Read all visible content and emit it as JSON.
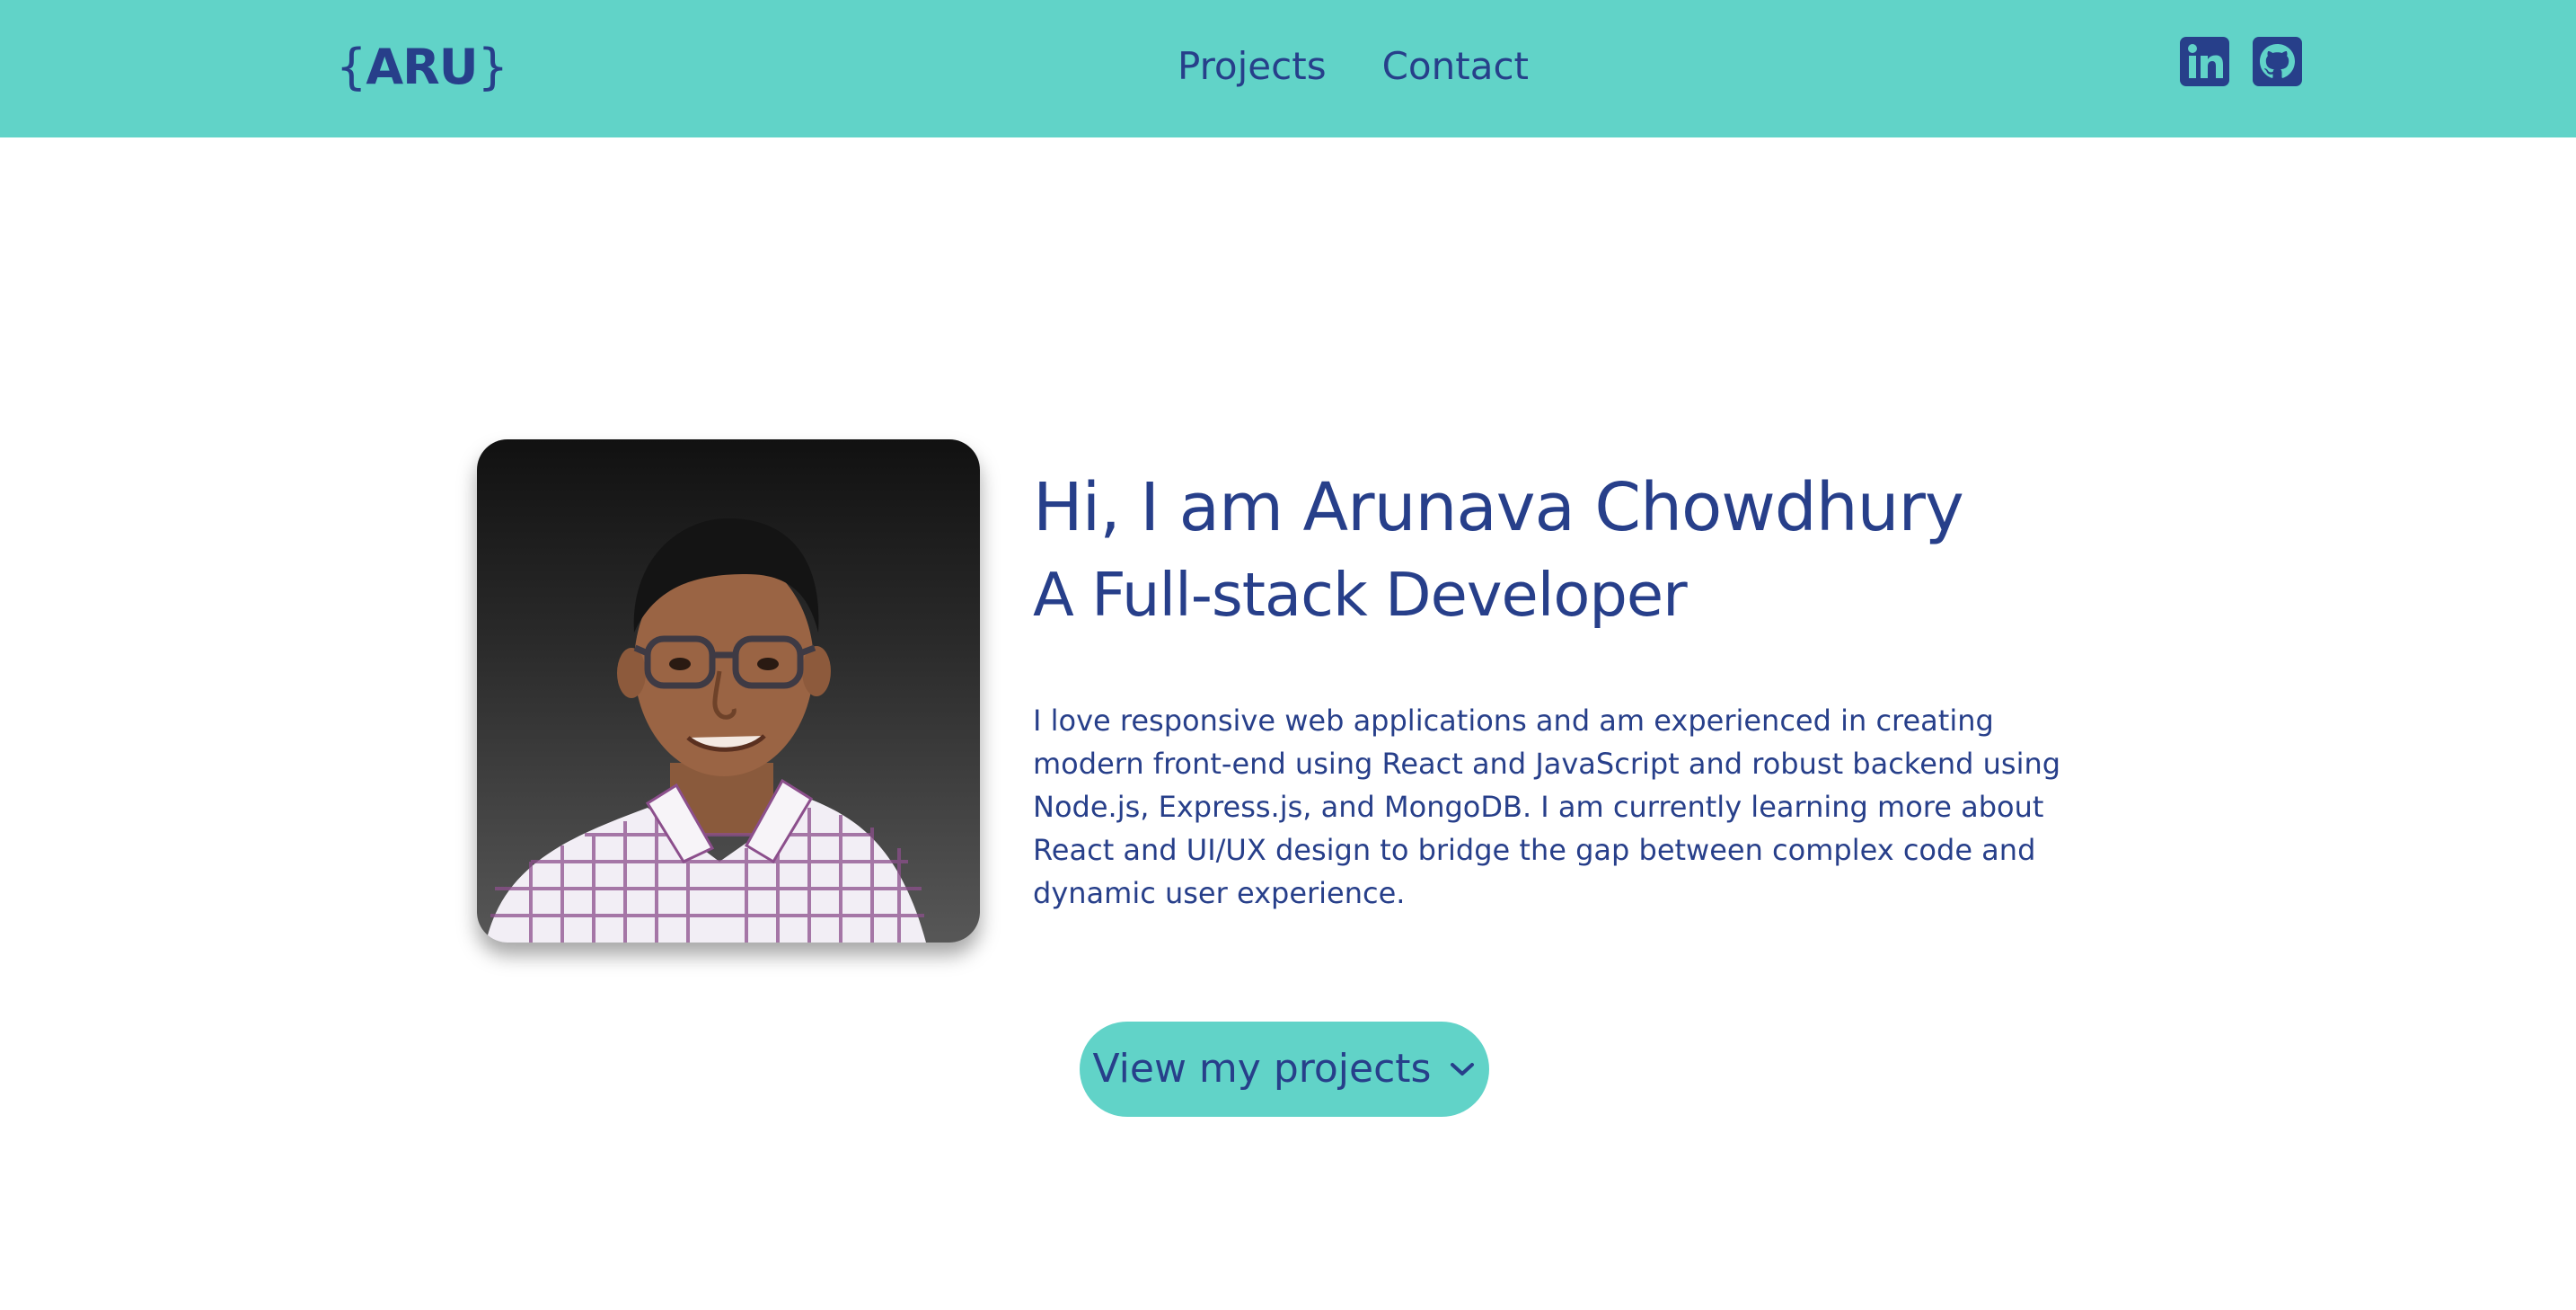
{
  "header": {
    "logo": {
      "open_brace": "{",
      "text": "ARU",
      "close_brace": "}"
    },
    "nav": [
      {
        "label": "Projects"
      },
      {
        "label": "Contact"
      }
    ],
    "socials": [
      {
        "icon": "linkedin-icon"
      },
      {
        "icon": "github-icon"
      }
    ]
  },
  "hero": {
    "headline": "Hi, I am Arunava Chowdhury",
    "subheadline": "A Full-stack Developer",
    "bio": "I love responsive web applications and am experienced in creating modern front-end using React and JavaScript and robust backend using Node.js, Express.js, and MongoDB. I am currently learning more about React and UI/UX design to bridge the gap between complex code and dynamic user experience.",
    "cta_label": "View my projects",
    "cta_icon": "chevron-down-icon"
  },
  "colors": {
    "accent": "#61d3c8",
    "text": "#273f8a",
    "background": "#ffffff"
  }
}
